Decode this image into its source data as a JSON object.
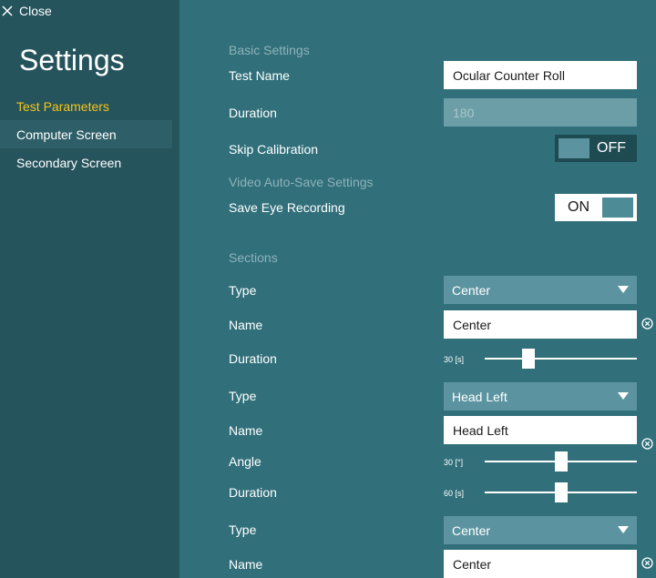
{
  "header": {
    "close_label": "Close"
  },
  "sidebar": {
    "title": "Settings",
    "items": [
      {
        "label": "Test Parameters"
      },
      {
        "label": "Computer Screen"
      },
      {
        "label": "Secondary Screen"
      }
    ]
  },
  "basic": {
    "heading": "Basic Settings",
    "test_name_label": "Test Name",
    "test_name_value": "Ocular Counter Roll",
    "duration_label": "Duration",
    "duration_value": "180",
    "skip_calibration_label": "Skip Calibration",
    "skip_calibration_state": "OFF"
  },
  "video": {
    "heading": "Video Auto-Save Settings",
    "save_eye_label": "Save Eye Recording",
    "save_eye_state": "ON"
  },
  "sections": {
    "heading": "Sections",
    "items": [
      {
        "type_label": "Type",
        "type_value": "Center",
        "name_label": "Name",
        "name_value": "Center",
        "duration_label": "Duration",
        "duration_value": "30 [s]",
        "duration_level": 0.27
      },
      {
        "type_label": "Type",
        "type_value": "Head Left",
        "name_label": "Name",
        "name_value": "Head Left",
        "angle_label": "Angle",
        "angle_value": "30 [°]",
        "angle_level": 0.5,
        "duration_label": "Duration",
        "duration_value": "60 [s]",
        "duration_level": 0.5
      },
      {
        "type_label": "Type",
        "type_value": "Center",
        "name_label": "Name",
        "name_value": "Center"
      }
    ]
  },
  "colors": {
    "sidebar_bg": "#26545d",
    "main_bg": "#31707b",
    "accent": "#f5c518",
    "select_bg": "#5b94a0"
  }
}
